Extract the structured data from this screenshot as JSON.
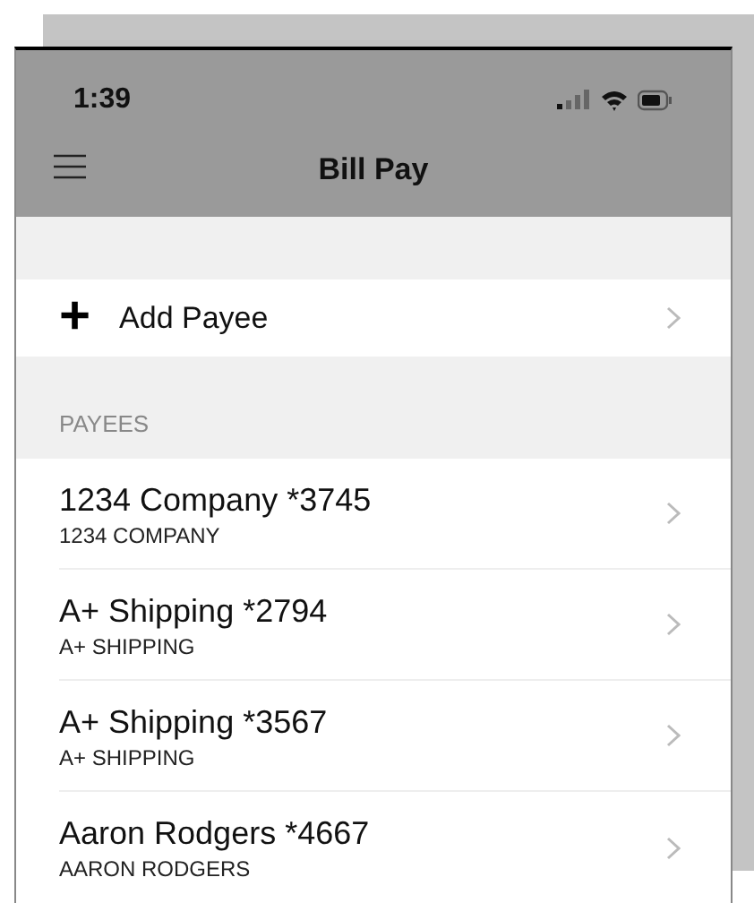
{
  "status_bar": {
    "time": "1:39"
  },
  "nav_bar": {
    "title": "Bill Pay"
  },
  "add_payee": {
    "icon": "+",
    "label": "Add Payee"
  },
  "section_header": "PAYEES",
  "payees": [
    {
      "name": "1234 Company *3745",
      "subtitle": "1234 COMPANY"
    },
    {
      "name": "A+ Shipping *2794",
      "subtitle": "A+ SHIPPING"
    },
    {
      "name": "A+ Shipping *3567",
      "subtitle": "A+ SHIPPING"
    },
    {
      "name": "Aaron Rodgers *4667",
      "subtitle": "AARON RODGERS"
    }
  ]
}
